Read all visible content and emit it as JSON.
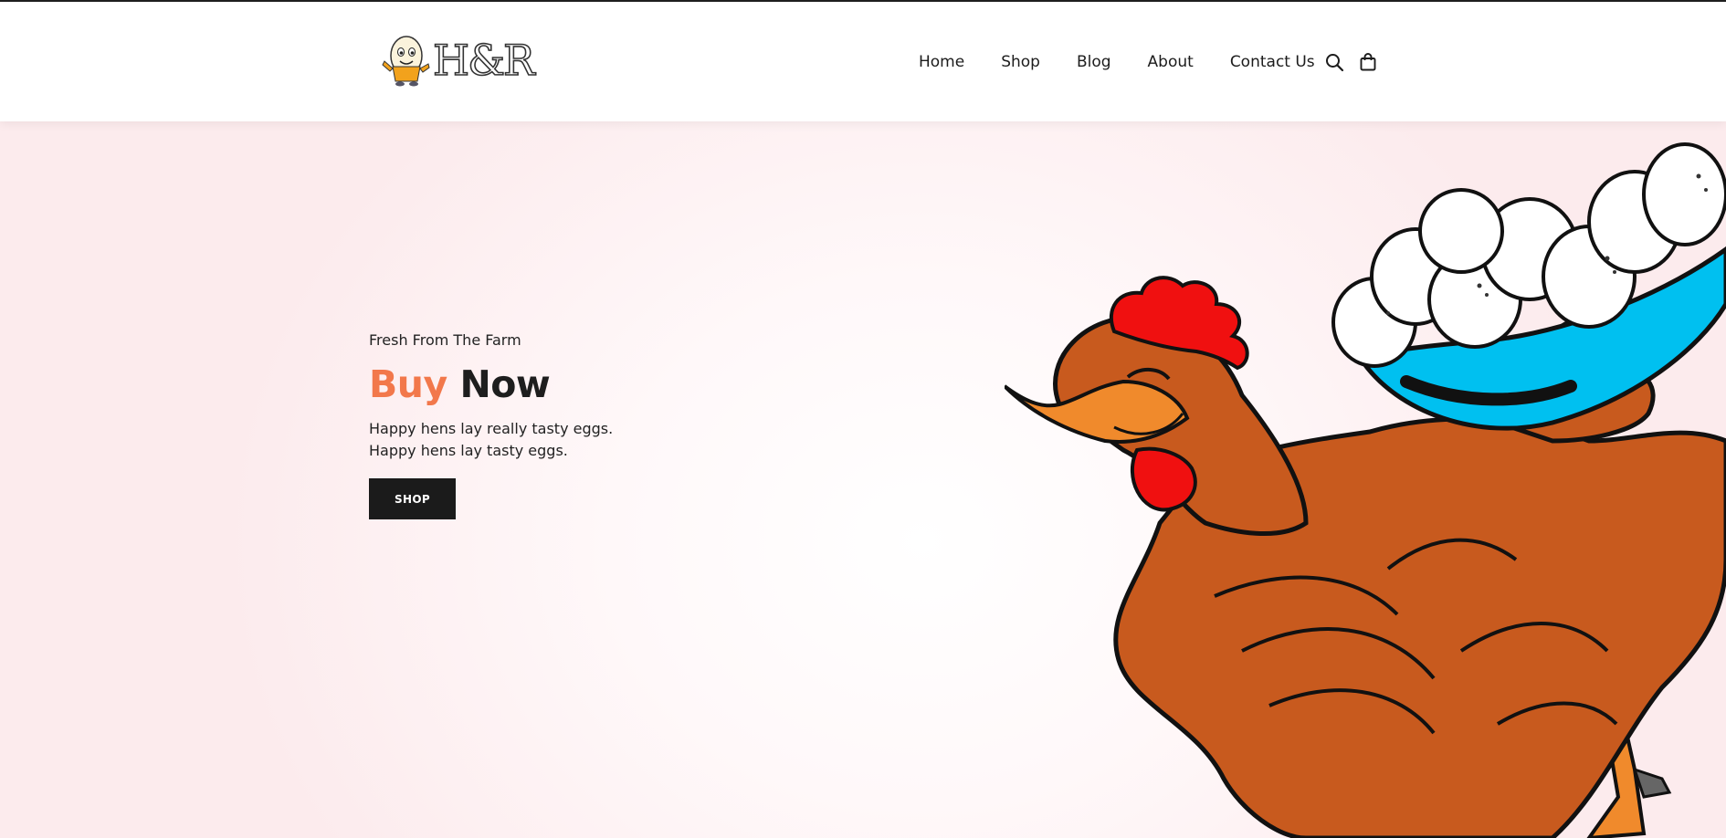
{
  "brand": {
    "logo_text": "H&R",
    "mascot_icon": "egg-mascot-icon"
  },
  "nav": {
    "items": [
      {
        "label": "Home"
      },
      {
        "label": "Shop"
      },
      {
        "label": "Blog"
      },
      {
        "label": "About"
      },
      {
        "label": "Contact Us"
      }
    ],
    "icons": [
      "search-icon",
      "shopping-bag-icon"
    ]
  },
  "hero": {
    "eyebrow": "Fresh From The Farm",
    "title_accent": "Buy",
    "title_main": "Now",
    "description_lines": [
      "Happy hens lay really tasty eggs.",
      "Happy hens lay tasty eggs."
    ],
    "button_label": "SHOP",
    "illustration": "hen-with-egg-bowl-illustration"
  },
  "colors": {
    "accent": "#f2784b",
    "dark": "#1b1b1b",
    "hero_background": "#fcebed",
    "hen_body": "#c85a1e",
    "bowl": "#00c0f0",
    "comb": "#f01010"
  }
}
